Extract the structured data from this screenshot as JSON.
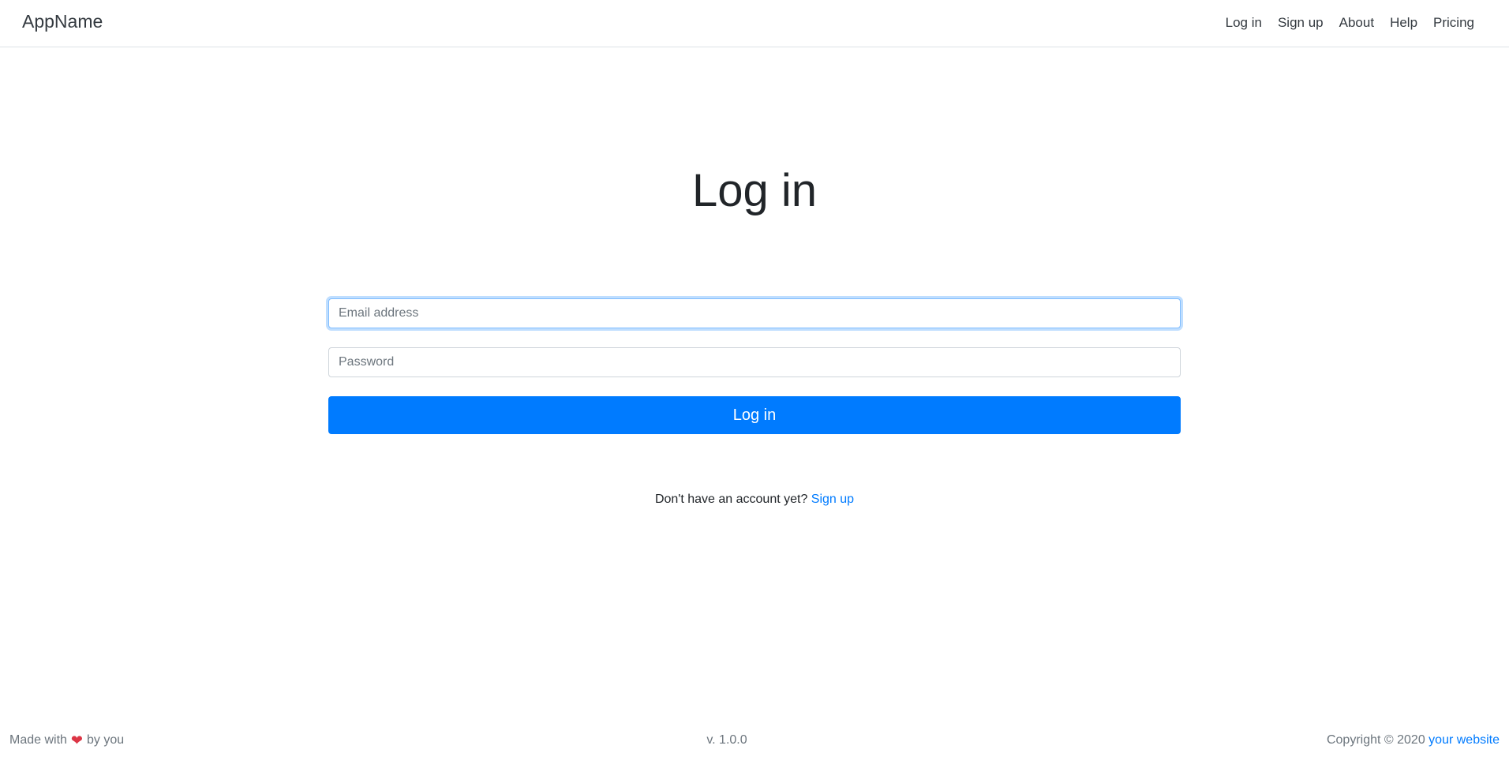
{
  "navbar": {
    "brand": "AppName",
    "links": [
      {
        "label": "Log in"
      },
      {
        "label": "Sign up"
      },
      {
        "label": "About"
      },
      {
        "label": "Help"
      },
      {
        "label": "Pricing"
      }
    ]
  },
  "login": {
    "title": "Log in",
    "email": {
      "placeholder": "Email address",
      "value": ""
    },
    "password": {
      "placeholder": "Password",
      "value": ""
    },
    "submit_label": "Log in",
    "signup_prompt": "Don't have an account yet?",
    "signup_link": "Sign up"
  },
  "footer": {
    "made_with_prefix": "Made with",
    "heart_icon": "heart-icon",
    "made_with_suffix": "by you",
    "version": "v. 1.0.0",
    "copyright": "Copyright © 2020",
    "website_link": "your website"
  },
  "colors": {
    "primary": "#007bff",
    "heart": "#dc3545",
    "muted": "#6c757d"
  }
}
